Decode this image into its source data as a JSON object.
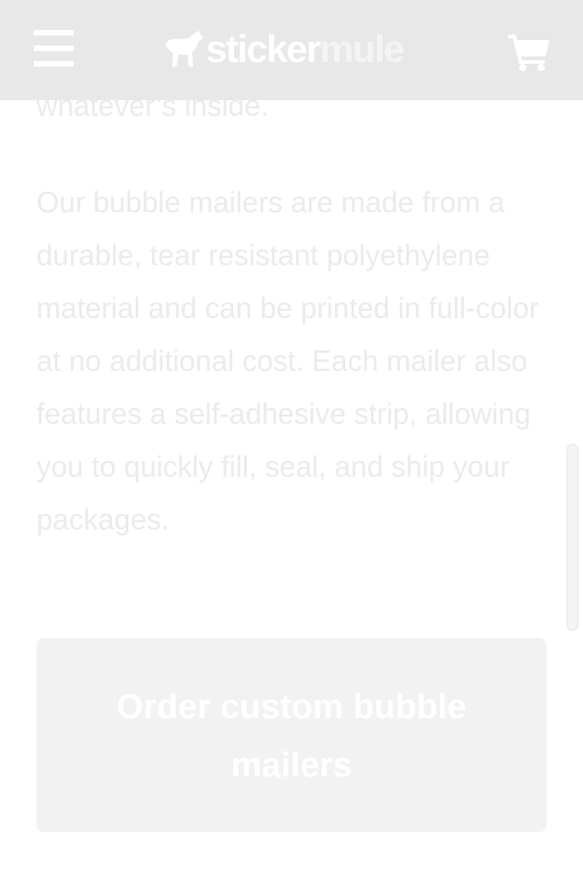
{
  "header": {
    "logo_part1": "sticker",
    "logo_part2": "mule",
    "menu_icon": "hamburger-menu-icon",
    "cart_icon": "shopping-cart-icon"
  },
  "content": {
    "previous_line": "whatever’s inside.",
    "paragraph": "Our bubble mailers are made from a durable, tear resistant polyethylene material and can be printed in full-color at no additional cost. Each mailer also features a self-adhesive strip, allowing you to quickly fill, seal, and ship your packages."
  },
  "cta": {
    "label": "Order custom bubble mailers"
  },
  "colors": {
    "header_bg": "#e8e8e8",
    "text": "#ebebeb",
    "button_bg": "#f2f2f2",
    "button_text": "#ffffff"
  }
}
